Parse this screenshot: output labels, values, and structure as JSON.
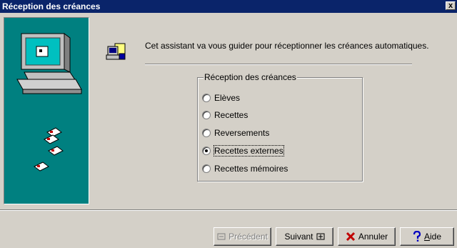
{
  "window": {
    "title": "Réception des créances",
    "close_label": "x"
  },
  "intro_text": "Cet assistant va vous guider pour réceptionner les créances automatiques.",
  "group": {
    "legend": "Réception des créances",
    "options": [
      {
        "label": "Elèves",
        "checked": false
      },
      {
        "label": "Recettes",
        "checked": false
      },
      {
        "label": "Reversements",
        "checked": false
      },
      {
        "label": "Recettes externes",
        "checked": true
      },
      {
        "label": "Recettes mémoires",
        "checked": false
      }
    ]
  },
  "buttons": {
    "previous": {
      "label": "Précédent",
      "icon": "back-arrow-icon",
      "disabled": true
    },
    "next": {
      "label": "Suivant",
      "icon": "forward-arrow-icon"
    },
    "cancel": {
      "label": "Annuler",
      "icon": "red-x-icon"
    },
    "help": {
      "label_prefix": "",
      "label_underlined": "A",
      "label_rest": "ide",
      "icon": "question-mark-icon"
    }
  },
  "colors": {
    "titlebar": "#0a246a",
    "sidepanel": "#008080",
    "face": "#d4d0c8"
  }
}
